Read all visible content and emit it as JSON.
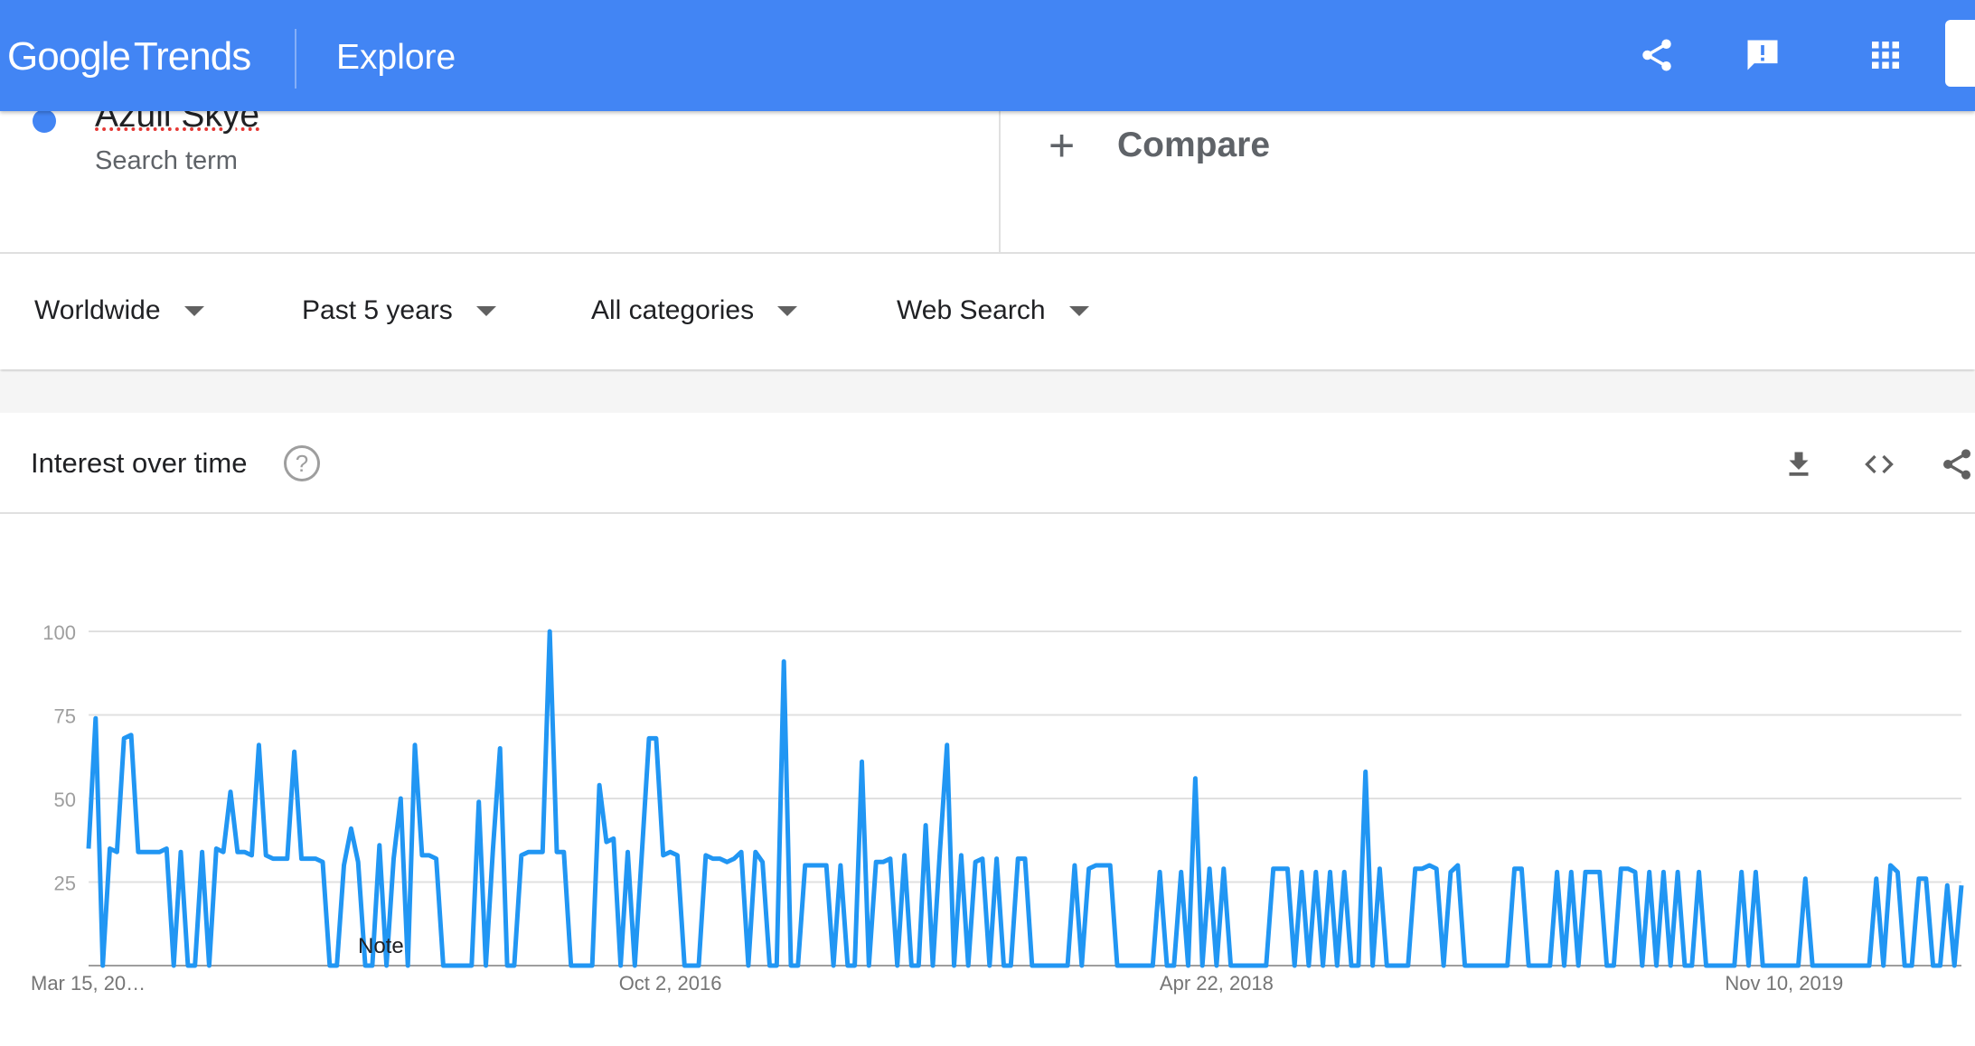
{
  "header": {
    "logo_google": "Google",
    "logo_trends": "Trends",
    "section": "Explore",
    "icons": [
      "share-icon",
      "feedback-icon",
      "apps-icon"
    ],
    "brand_color": "#4285f4"
  },
  "term": {
    "name": "Azuli Skye",
    "type": "Search term",
    "color": "#4285f4"
  },
  "compare_label": "Compare",
  "filters": {
    "region": "Worldwide",
    "time": "Past 5 years",
    "category": "All categories",
    "property": "Web Search"
  },
  "card": {
    "title": "Interest over time",
    "help": "?",
    "icons": [
      "download-icon",
      "embed-code-icon",
      "share-icon"
    ]
  },
  "chart_data": {
    "type": "line",
    "title": "Interest over time",
    "xlabel": "",
    "ylabel": "",
    "ylim": [
      0,
      100
    ],
    "yticks": [
      "25",
      "50",
      "75",
      "100"
    ],
    "xticks": [
      "Mar 15, 20…",
      "Oct 2, 2016",
      "Apr 22, 2018",
      "Nov 10, 2019"
    ],
    "annotations": [
      "Note"
    ],
    "grid": true,
    "line_color": "#2196f3",
    "series": [
      {
        "values": [
          35,
          74,
          0,
          35,
          34,
          68,
          69,
          34,
          34,
          34,
          34,
          35,
          0,
          34,
          0,
          0,
          34,
          0,
          35,
          34,
          52,
          34,
          34,
          33,
          66,
          33,
          32,
          32,
          32,
          64,
          32,
          32,
          32,
          31,
          0,
          0,
          30,
          41,
          31,
          0,
          0,
          36,
          0,
          32,
          50,
          0,
          66,
          33,
          33,
          32,
          0,
          0,
          0,
          0,
          0,
          49,
          0,
          35,
          65,
          0,
          0,
          33,
          34,
          34,
          34,
          100,
          34,
          34,
          0,
          0,
          0,
          0,
          54,
          37,
          38,
          0,
          34,
          0,
          34,
          68,
          68,
          33,
          34,
          33,
          0,
          0,
          0,
          33,
          32,
          32,
          31,
          32,
          34,
          0,
          34,
          31,
          0,
          0,
          91,
          0,
          0,
          30,
          30,
          30,
          30,
          0,
          30,
          0,
          0,
          61,
          0,
          31,
          31,
          32,
          0,
          33,
          0,
          0,
          42,
          0,
          34,
          66,
          0,
          33,
          0,
          31,
          32,
          0,
          32,
          0,
          0,
          32,
          32,
          0,
          0,
          0,
          0,
          0,
          0,
          30,
          0,
          29,
          30,
          30,
          30,
          0,
          0,
          0,
          0,
          0,
          0,
          28,
          0,
          0,
          28,
          0,
          56,
          0,
          29,
          0,
          29,
          0,
          0,
          0,
          0,
          0,
          0,
          29,
          29,
          29,
          0,
          28,
          0,
          28,
          0,
          28,
          0,
          28,
          0,
          0,
          58,
          0,
          29,
          0,
          0,
          0,
          0,
          29,
          29,
          30,
          29,
          0,
          28,
          30,
          0,
          0,
          0,
          0,
          0,
          0,
          0,
          29,
          29,
          0,
          0,
          0,
          0,
          28,
          0,
          28,
          0,
          28,
          28,
          28,
          0,
          0,
          29,
          29,
          28,
          0,
          28,
          0,
          28,
          0,
          28,
          0,
          0,
          28,
          0,
          0,
          0,
          0,
          0,
          28,
          0,
          28,
          0,
          0,
          0,
          0,
          0,
          0,
          26,
          0,
          0,
          0,
          0,
          0,
          0,
          0,
          0,
          0,
          26,
          0,
          30,
          28,
          0,
          0,
          26,
          26,
          0,
          0,
          24,
          0,
          24
        ]
      }
    ]
  }
}
